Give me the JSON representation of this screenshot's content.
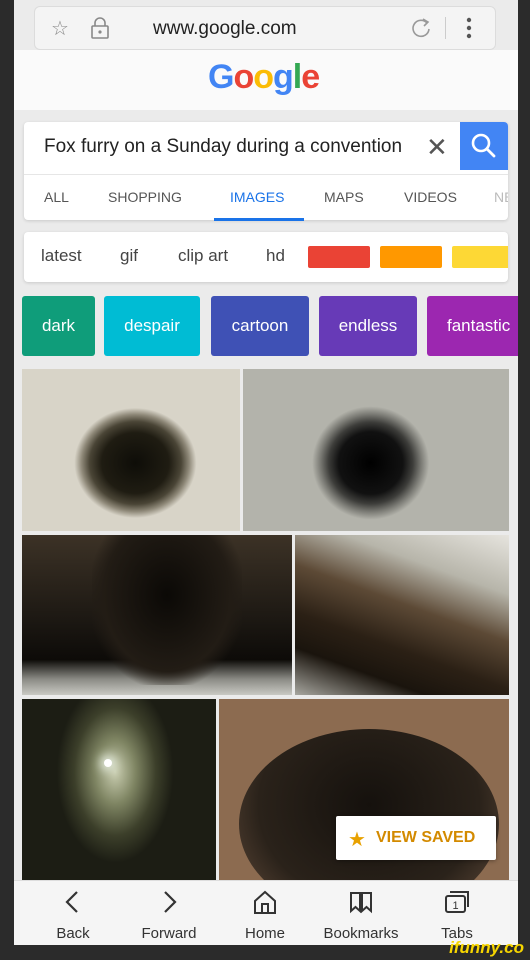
{
  "browser": {
    "url": "www.google.com",
    "star_icon": "star-outline-icon",
    "lock_icon": "lock-icon",
    "reload_icon": "reload-icon",
    "menu_icon": "vertical-dots-icon"
  },
  "google": {
    "logo": "Google",
    "logo_colors": [
      "#4285f4",
      "#ea4335",
      "#fbbc05",
      "#4285f4",
      "#34a853",
      "#ea4335"
    ]
  },
  "search": {
    "query": "Fox furry on a Sunday during a convention",
    "clear_label": "✕",
    "button_color": "#4285f4"
  },
  "tabs": [
    {
      "label": "ALL"
    },
    {
      "label": "SHOPPING"
    },
    {
      "label": "IMAGES",
      "active": true
    },
    {
      "label": "MAPS"
    },
    {
      "label": "VIDEOS"
    },
    {
      "label": "NE"
    }
  ],
  "filters": [
    {
      "label": "latest"
    },
    {
      "label": "gif"
    },
    {
      "label": "clip art"
    },
    {
      "label": "hd"
    }
  ],
  "color_filters": [
    "#ea4335",
    "#ff9800",
    "#fdd835"
  ],
  "chips": [
    {
      "label": "dark",
      "color": "#0f9d7a"
    },
    {
      "label": "despair",
      "color": "#00bcd4"
    },
    {
      "label": "cartoon",
      "color": "#3f51b5"
    },
    {
      "label": "endless",
      "color": "#673ab7"
    },
    {
      "label": "fantastic",
      "color": "#9c27b0"
    }
  ],
  "results": [
    {
      "subject": "stone well shaft"
    },
    {
      "subject": "stone well shaft"
    },
    {
      "subject": "rock pit"
    },
    {
      "subject": "rock pit"
    },
    {
      "subject": "cave shaft"
    },
    {
      "subject": "dirt hole"
    }
  ],
  "view_saved": {
    "label": "VIEW SAVED",
    "icon": "star-icon"
  },
  "bottom_nav": [
    {
      "label": "Back",
      "icon": "chevron-left-icon"
    },
    {
      "label": "Forward",
      "icon": "chevron-right-icon"
    },
    {
      "label": "Home",
      "icon": "home-icon"
    },
    {
      "label": "Bookmarks",
      "icon": "bookmarks-icon"
    },
    {
      "label": "Tabs",
      "icon": "tabs-icon"
    }
  ],
  "tab_count": "1",
  "watermark": "ifunny.co"
}
